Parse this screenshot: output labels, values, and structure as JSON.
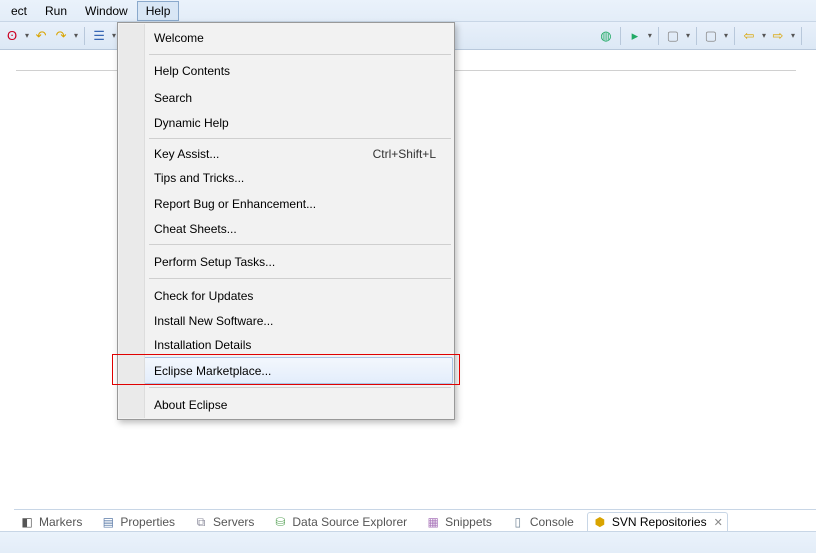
{
  "menubar": {
    "items": [
      {
        "label": "ect"
      },
      {
        "label": "Run"
      },
      {
        "label": "Window"
      },
      {
        "label": "Help"
      }
    ],
    "active_index": 3
  },
  "help_menu": {
    "groups": [
      [
        {
          "label": "Welcome",
          "icon": "welcome-icon"
        }
      ],
      [
        {
          "label": "Help Contents",
          "icon": "help-icon"
        },
        {
          "label": "Search",
          "icon": "search-help-icon"
        },
        {
          "label": "Dynamic Help",
          "icon": ""
        }
      ],
      [
        {
          "label": "Key Assist...",
          "shortcut": "Ctrl+Shift+L",
          "icon": ""
        },
        {
          "label": "Tips and Tricks...",
          "icon": ""
        },
        {
          "label": "Report Bug or Enhancement...",
          "icon": "bug-icon"
        },
        {
          "label": "Cheat Sheets...",
          "icon": ""
        }
      ],
      [
        {
          "label": "Perform Setup Tasks...",
          "icon": "setup-icon"
        }
      ],
      [
        {
          "label": "Check for Updates",
          "icon": "updates-icon"
        },
        {
          "label": "Install New Software...",
          "icon": ""
        },
        {
          "label": "Installation Details",
          "icon": ""
        },
        {
          "label": "Eclipse Marketplace...",
          "icon": "marketplace-icon",
          "hover": true,
          "highlight": true
        }
      ],
      [
        {
          "label": "About Eclipse",
          "icon": "about-icon"
        }
      ]
    ]
  },
  "bottom_tabs": {
    "items": [
      {
        "label": "Markers",
        "icon": "markers-icon"
      },
      {
        "label": "Properties",
        "icon": "properties-icon"
      },
      {
        "label": "Servers",
        "icon": "servers-icon"
      },
      {
        "label": "Data Source Explorer",
        "icon": "datasource-icon"
      },
      {
        "label": "Snippets",
        "icon": "snippets-icon"
      },
      {
        "label": "Console",
        "icon": "console-icon"
      },
      {
        "label": "SVN Repositories",
        "icon": "svn-icon",
        "active": true,
        "closeable": true
      }
    ]
  }
}
